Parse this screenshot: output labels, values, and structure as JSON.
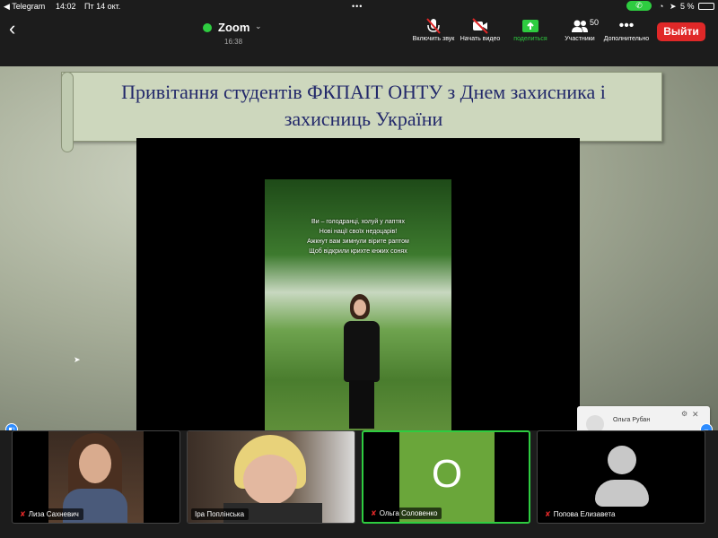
{
  "status_bar": {
    "back_app": "◀ Telegram",
    "time": "14:02",
    "date": "Пт 14 окт.",
    "battery": "5 %"
  },
  "header": {
    "app_name": "Zoom",
    "duration": "16:38",
    "leave_label": "Выйти"
  },
  "toolbar": [
    {
      "label": "Включить звук",
      "icon": "mic-off-icon"
    },
    {
      "label": "Начать видео",
      "icon": "video-off-icon"
    },
    {
      "label": "поделиться",
      "icon": "share-icon"
    },
    {
      "label": "Участники",
      "icon": "participants-icon",
      "badge": "50"
    },
    {
      "label": "Дополнительно",
      "icon": "more-icon"
    }
  ],
  "share": {
    "title": "Привітання студентів ФКПАІТ ОНТУ  з Днем захисника і захисниць України",
    "poem": [
      "Ви – голодранці, холуй у лаптях",
      "Нові нації своїх недоцарів!",
      "Ажкнут вам зимнули вірите раптом",
      "Щоб відкрили крихте кнжих сонях"
    ]
  },
  "popup": {
    "name": "Ольга Рубан"
  },
  "participants": [
    {
      "name": "Лиза Сахневич",
      "muted": true,
      "type": "video"
    },
    {
      "name": "Іра Поплінська",
      "muted": false,
      "type": "video"
    },
    {
      "name": "Ольга Соловенко",
      "muted": true,
      "type": "initial",
      "initial": "O",
      "active": true
    },
    {
      "name": "Попова Елизавета",
      "muted": true,
      "type": "avatar"
    }
  ],
  "colors": {
    "accent_green": "#2ecc40",
    "leave_red": "#e02828",
    "title_blue": "#22286a"
  }
}
